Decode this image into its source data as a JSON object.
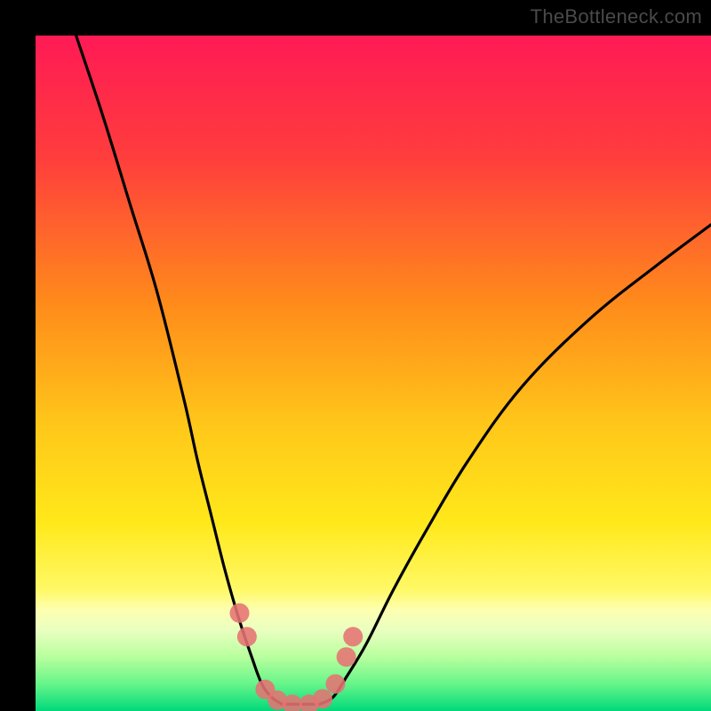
{
  "watermark": "TheBottleneck.com",
  "chart_data": {
    "type": "line",
    "title": "",
    "xlabel": "",
    "ylabel": "",
    "xlim": [
      0,
      100
    ],
    "ylim": [
      0,
      100
    ],
    "background_gradient": {
      "top": "#ff1a4d",
      "upper_mid": "#ff7a1a",
      "mid": "#ffd400",
      "lower_mid": "#f9f97a",
      "green_band_top": "#d9ff70",
      "green_band_bottom": "#00e676"
    },
    "series": [
      {
        "name": "left-curve",
        "x": [
          6,
          10,
          14,
          18,
          22,
          24,
          26,
          28,
          30,
          32,
          33.5,
          35,
          36.5
        ],
        "y": [
          100,
          88,
          75,
          62,
          46,
          37,
          29,
          21,
          14,
          8,
          4,
          2,
          1
        ]
      },
      {
        "name": "right-curve",
        "x": [
          42,
          44,
          46,
          49,
          53,
          58,
          64,
          72,
          82,
          92,
          100
        ],
        "y": [
          1,
          2,
          5,
          10,
          18,
          27,
          37,
          48,
          58,
          66,
          72
        ]
      },
      {
        "name": "valley-flat",
        "x": [
          36.5,
          42
        ],
        "y": [
          1,
          1
        ]
      }
    ],
    "points": [
      {
        "name": "p1",
        "x": 30.2,
        "y": 14.5
      },
      {
        "name": "p2",
        "x": 31.3,
        "y": 11.0
      },
      {
        "name": "p3",
        "x": 34.0,
        "y": 3.2
      },
      {
        "name": "p4",
        "x": 35.8,
        "y": 1.6
      },
      {
        "name": "p5",
        "x": 38.0,
        "y": 1.0
      },
      {
        "name": "p6",
        "x": 40.5,
        "y": 1.0
      },
      {
        "name": "p7",
        "x": 42.5,
        "y": 1.8
      },
      {
        "name": "p8",
        "x": 44.4,
        "y": 4.0
      },
      {
        "name": "p9",
        "x": 46.0,
        "y": 8.0
      },
      {
        "name": "p10",
        "x": 47.0,
        "y": 11.0
      }
    ],
    "point_color": "#e57373",
    "curve_color": "#000000"
  }
}
